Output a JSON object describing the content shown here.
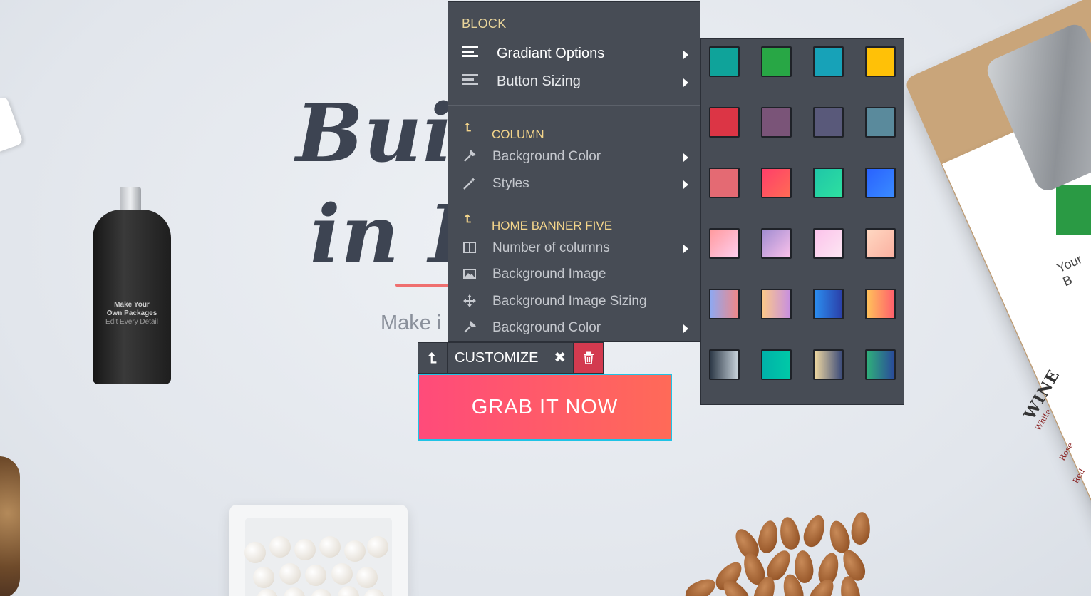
{
  "headline": {
    "line1": "Buil",
    "line2": "in R",
    "subtitle": "Make i"
  },
  "grinder": {
    "line1": "Make Your",
    "line2": "Own Packages",
    "line3": "Edit Every Detail"
  },
  "clipboard": {
    "title": "Your B",
    "wine": "WINE",
    "white": "White",
    "rose": "Rose",
    "red": "Red"
  },
  "menu": {
    "block_header": "BLOCK",
    "block_items": [
      {
        "label": "Gradiant Options",
        "icon": "lines-icon",
        "submenu": true
      },
      {
        "label": "Button Sizing",
        "icon": "lines-icon",
        "submenu": true
      }
    ],
    "column_header": "COLUMN",
    "column_items": [
      {
        "label": "Background Color",
        "icon": "eyedropper-icon",
        "submenu": true
      },
      {
        "label": "Styles",
        "icon": "magic-wand-icon",
        "submenu": true
      }
    ],
    "banner_header": "HOME BANNER FIVE",
    "banner_items": [
      {
        "label": "Number of columns",
        "icon": "columns-icon",
        "submenu": true
      },
      {
        "label": "Background Image",
        "icon": "image-icon",
        "submenu": false
      },
      {
        "label": "Background Image Sizing",
        "icon": "move-icon",
        "submenu": false
      },
      {
        "label": "Background Color",
        "icon": "eyedropper-icon",
        "submenu": true
      }
    ]
  },
  "swatches": [
    [
      "#0fa39a",
      "#28a745",
      "#17a2b8",
      "#ffc107"
    ],
    [
      "#dc3545",
      "#7a5478",
      "#59597a",
      "#5a8a9c"
    ],
    [
      "#e46a73",
      "linear-gradient(135deg,#ff3f6a,#ff6b55)",
      "linear-gradient(135deg,#1fc6a8,#2ee0a0)",
      "linear-gradient(135deg,#2962ff,#3a8bff)"
    ],
    [
      "linear-gradient(135deg,#ff9a9e,#fecfef)",
      "linear-gradient(135deg,#a18cd1,#fbc2eb)",
      "linear-gradient(135deg,#fbc2eb,#fde7f3)",
      "linear-gradient(135deg,#ffd8c2,#fbb0a0)"
    ],
    [
      "linear-gradient(90deg,#8fa8f0,#f08888)",
      "linear-gradient(90deg,#fbc88a,#c78fe0)",
      "linear-gradient(90deg,#2b8ef0,#2b3fa8)",
      "linear-gradient(90deg,#ffc35a,#ff5f6d)"
    ],
    [
      "linear-gradient(90deg,#2e3a48,#c9d4dc)",
      "linear-gradient(90deg,#00b2a9,#00c9a7)",
      "linear-gradient(90deg,#f0d8a0,#3a4a7a)",
      "linear-gradient(90deg,#2fb07a,#2a4a9a)"
    ]
  ],
  "toolbar": {
    "label": "CUSTOMIZE",
    "close": "✖",
    "up": "⮤"
  },
  "button": {
    "label": "GRAB IT NOW"
  }
}
